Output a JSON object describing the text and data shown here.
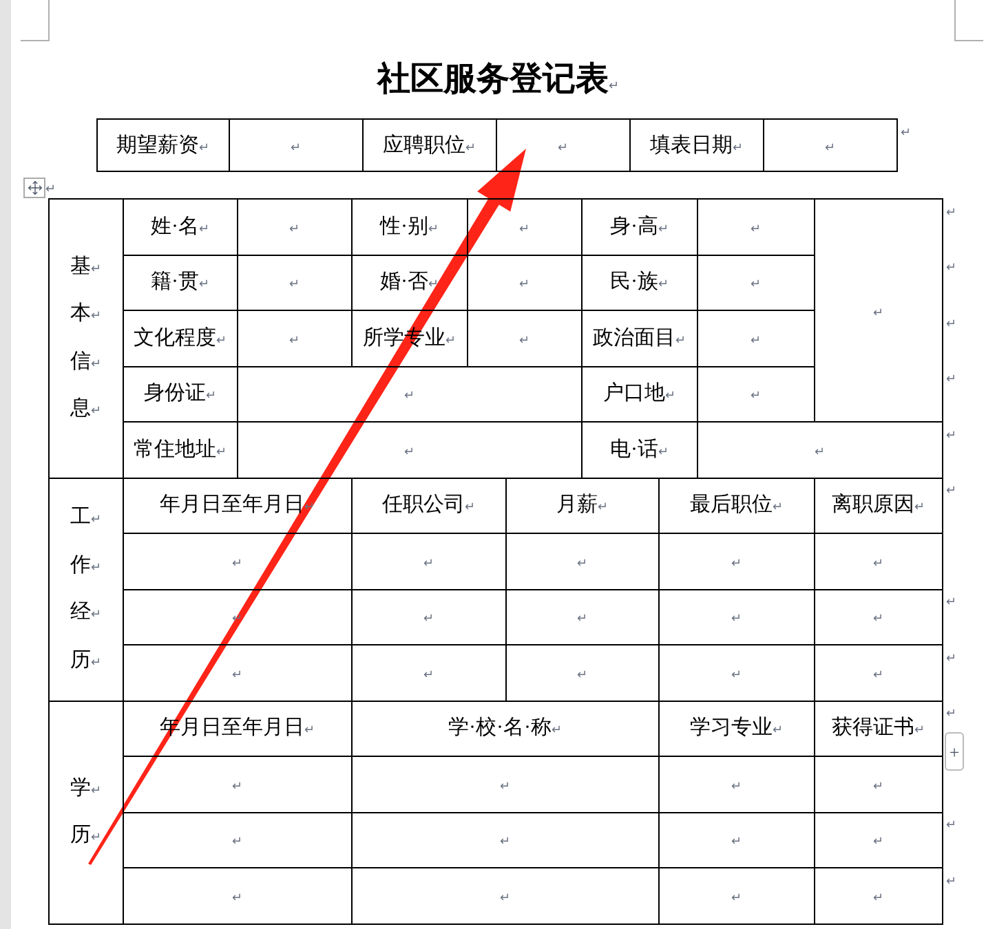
{
  "title": {
    "text": "社区服务登记表",
    "mark": "↵"
  },
  "info_row": {
    "cells": [
      {
        "text": "期望薪资",
        "mark": "↵"
      },
      {
        "mark": "↵"
      },
      {
        "text": "应聘职位",
        "mark": "↵"
      },
      {
        "mark": "↵"
      },
      {
        "text": "填表日期",
        "mark": "↵"
      },
      {
        "mark": "↵"
      }
    ],
    "end_mark": "↵"
  },
  "table_handle_mark": "↵",
  "sections": [
    {
      "kind": "basic",
      "label": [
        {
          "text": "基",
          "mark": "↵"
        },
        {
          "text": "本",
          "mark": "↵"
        },
        {
          "text": "信",
          "mark": "↵"
        },
        {
          "text": "息",
          "mark": "↵"
        }
      ],
      "rows": [
        {
          "cells": [
            {
              "text": "姓·名",
              "mark": "↵"
            },
            {
              "mark": "↵"
            },
            {
              "text": "性·别",
              "mark": "↵"
            },
            {
              "mark": "↵"
            },
            {
              "text": "身·高",
              "mark": "↵"
            },
            {
              "mark": "↵"
            },
            {
              "mark": "↵",
              "rowspan": 4
            }
          ],
          "end_mark": "↵"
        },
        {
          "cells": [
            {
              "text": "籍·贯",
              "mark": "↵"
            },
            {
              "mark": "↵"
            },
            {
              "text": "婚·否",
              "mark": "↵"
            },
            {
              "mark": "↵"
            },
            {
              "text": "民·族",
              "mark": "↵"
            },
            {
              "mark": "↵"
            }
          ],
          "end_mark": "↵"
        },
        {
          "cells": [
            {
              "text": "文化程度",
              "mark": "↵"
            },
            {
              "mark": "↵"
            },
            {
              "text": "所学专业",
              "mark": "↵"
            },
            {
              "mark": "↵"
            },
            {
              "text": "政治面目",
              "mark": "↵"
            },
            {
              "mark": "↵"
            }
          ],
          "end_mark": "↵"
        },
        {
          "cells": [
            {
              "text": "身份证",
              "mark": "↵"
            },
            {
              "mark": "↵",
              "colspan": 3
            },
            {
              "text": "户口地",
              "mark": "↵"
            },
            {
              "mark": "↵"
            }
          ],
          "end_mark": "↵"
        },
        {
          "cells": [
            {
              "text": "常住地址",
              "mark": "↵"
            },
            {
              "mark": "↵",
              "colspan": 3
            },
            {
              "text": "电·话",
              "mark": "↵"
            },
            {
              "mark": "↵",
              "colspan": 2
            }
          ],
          "end_mark": "↵"
        }
      ]
    },
    {
      "kind": "work",
      "label": [
        {
          "text": "工",
          "mark": "↵"
        },
        {
          "text": "作",
          "mark": "↵"
        },
        {
          "text": "经",
          "mark": "↵"
        },
        {
          "text": "历",
          "mark": "↵"
        }
      ],
      "rows": [
        {
          "cells": [
            {
              "text": "年月日至年月日",
              "mark": "↵"
            },
            {
              "text": "任职公司",
              "mark": "↵"
            },
            {
              "text": "月薪",
              "mark": "↵"
            },
            {
              "text": "最后职位",
              "mark": "↵"
            },
            {
              "text": "离职原因",
              "mark": "↵"
            }
          ],
          "end_mark": "↵"
        },
        {
          "cells": [
            {
              "mark": "↵"
            },
            {
              "mark": "↵"
            },
            {
              "mark": "↵"
            },
            {
              "mark": "↵"
            },
            {
              "mark": "↵"
            }
          ]
        },
        {
          "cells": [
            {
              "mark": "↵"
            },
            {
              "mark": "↵"
            },
            {
              "mark": "↵"
            },
            {
              "mark": "↵"
            },
            {
              "mark": "↵"
            }
          ],
          "end_mark": "↵"
        },
        {
          "cells": [
            {
              "mark": "↵"
            },
            {
              "mark": "↵"
            },
            {
              "mark": "↵"
            },
            {
              "mark": "↵"
            },
            {
              "mark": "↵"
            }
          ],
          "end_mark": "↵"
        }
      ]
    },
    {
      "kind": "education",
      "label": [
        {
          "text": "学",
          "mark": "↵"
        },
        {
          "text": "历",
          "mark": "↵"
        }
      ],
      "rows": [
        {
          "cells": [
            {
              "text": "年月日至年月日",
              "mark": "↵"
            },
            {
              "text": "学·校·名·称",
              "mark": "↵"
            },
            {
              "text": "学习专业",
              "mark": "↵"
            },
            {
              "text": "获得证书",
              "mark": "↵"
            }
          ],
          "end_mark": "↵"
        },
        {
          "cells": [
            {
              "mark": "↵"
            },
            {
              "mark": "↵"
            },
            {
              "mark": "↵"
            },
            {
              "mark": "↵"
            }
          ]
        },
        {
          "cells": [
            {
              "mark": "↵"
            },
            {
              "mark": "↵"
            },
            {
              "mark": "↵"
            },
            {
              "mark": "↵"
            }
          ],
          "end_mark": "↵"
        },
        {
          "cells": [
            {
              "mark": "↵"
            },
            {
              "mark": "↵"
            },
            {
              "mark": "↵"
            },
            {
              "mark": "↵"
            }
          ],
          "end_mark": "↵"
        }
      ]
    }
  ],
  "add_row_button": "+"
}
